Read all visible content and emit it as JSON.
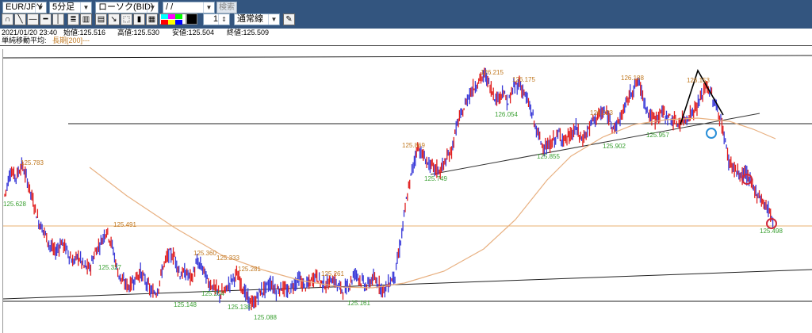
{
  "toolbar": {
    "symbol": "EUR/JPY",
    "timeframe": "5分足",
    "chart_type": "ローソク(BID)",
    "date_field": " /  / ",
    "search_label": "検索",
    "width_value": "1",
    "line_type": "通常線",
    "colors": [
      "#00ffff",
      "#ff00ff",
      "#00ff00",
      "#ff0000",
      "#ffff00",
      "#0000ff",
      "#ffffff",
      "#000000"
    ]
  },
  "info": {
    "datetime": "2021/01/20 23:40",
    "open": "始値:125.516",
    "high": "高値:125.530",
    "low": "安値:125.504",
    "close": "終値:125.509",
    "indicator_label": "単純移動平均:",
    "indicator_value": "長期[200]---"
  },
  "chart_data": {
    "type": "line",
    "series": [
      {
        "values": [
          125.63,
          125.75,
          125.72,
          125.78,
          125.7,
          125.6,
          125.5,
          125.45,
          125.38,
          125.35,
          125.4,
          125.36,
          125.3,
          125.33,
          125.28,
          125.27,
          125.35,
          125.4,
          125.46,
          125.38,
          125.25,
          125.2,
          125.18,
          125.22,
          125.25,
          125.2,
          125.15,
          125.16,
          125.28,
          125.34,
          125.33,
          125.24,
          125.25,
          125.22,
          125.3,
          125.27,
          125.2,
          125.18,
          125.14,
          125.16,
          125.21,
          125.24,
          125.18,
          125.12,
          125.09,
          125.15,
          125.17,
          125.2,
          125.16,
          125.18,
          125.15,
          125.19,
          125.22,
          125.18,
          125.2,
          125.24,
          125.2,
          125.19,
          125.22,
          125.18,
          125.16,
          125.2,
          125.25,
          125.21,
          125.18,
          125.22,
          125.2,
          125.16,
          125.2,
          125.24,
          125.4,
          125.6,
          125.75,
          125.87,
          125.82,
          125.78,
          125.76,
          125.75,
          125.8,
          125.85,
          125.98,
          126.04,
          126.12,
          126.16,
          126.2,
          126.22,
          126.15,
          126.1,
          126.14,
          126.08,
          126.16,
          126.18,
          126.12,
          126.05,
          125.95,
          125.88,
          125.86,
          125.9,
          125.93,
          125.9,
          125.92,
          125.96,
          125.9,
          125.94,
          126.0,
          126.02,
          126.04,
          126.0,
          125.96,
          126.02,
          126.09,
          126.15,
          126.19,
          126.1,
          126.02,
          126.0,
          126.04,
          126.02,
          126.0,
          125.98,
          126.0,
          126.02,
          126.05,
          126.1,
          126.17,
          126.12,
          126.05,
          125.95,
          125.8,
          125.76,
          125.72,
          125.74,
          125.68,
          125.64,
          125.6,
          125.56,
          125.5
        ]
      }
    ]
  },
  "ma": {
    "legend_color": "#d0a070",
    "series_color": "#e8b080"
  },
  "labels": {
    "highs": [
      "125.783",
      "125.491",
      "125.360",
      "125.333",
      "125.281",
      "125.261",
      "125.869",
      "126.215",
      "126.175",
      "126.023",
      "126.188",
      "126.153"
    ],
    "lows": [
      "125.628",
      "125.327",
      "125.148",
      "125.204",
      "125.138",
      "125.088",
      "125.161",
      "125.749",
      "126.054",
      "125.855",
      "125.902",
      "125.957",
      "125.498"
    ]
  },
  "colors": {
    "high_label": "#c07820",
    "low_label": "#3aa032",
    "up_candle": "#e01e1e",
    "down_candle": "#3a3ad8",
    "hline": "#e8b070",
    "circle_blue": "#2a8fd8",
    "circle_red": "#d0283c"
  }
}
